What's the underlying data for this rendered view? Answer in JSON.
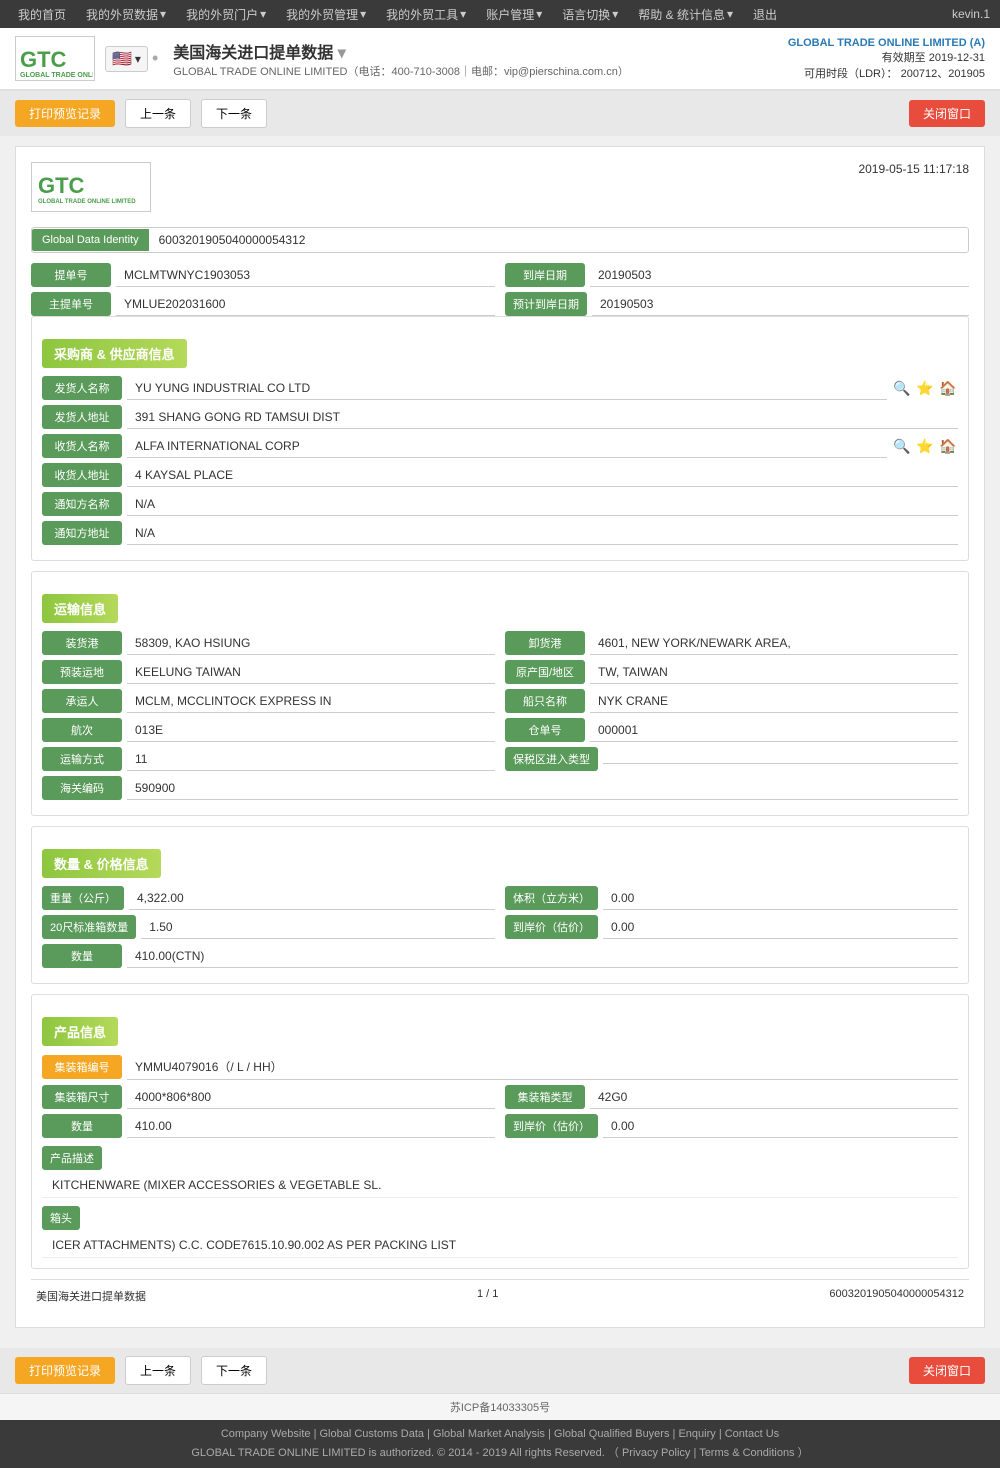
{
  "topnav": {
    "items": [
      "我的首页",
      "我的外贸数据",
      "我的外贸门户",
      "我的外贸管理",
      "我的外贸工具",
      "账户管理",
      "语言切换",
      "帮助 & 统计信息",
      "退出"
    ],
    "user": "kevin.1"
  },
  "header": {
    "logo_text": "GTC",
    "title": "美国海关进口提单数据",
    "subtitle": "GLOBAL TRADE ONLINE LIMITED（电话：400-710-3008｜电邮：vip@pierschina.com.cn）",
    "company": "GLOBAL TRADE ONLINE LIMITED (A)",
    "valid_until_label": "有效期至",
    "valid_until": "2019-12-31",
    "ldr_label": "可用时段（LDR）：",
    "ldr_value": "200712、201905"
  },
  "toolbar": {
    "print_label": "打印预览记录",
    "prev_label": "上一条",
    "next_label": "下一条",
    "close_label": "关闭窗口"
  },
  "document": {
    "date": "2019-05-15 11:17:18",
    "logo_text": "GTC",
    "gdi_label": "Global Data Identity",
    "gdi_value": "6003201905040000054312",
    "bill_no_label": "提单号",
    "bill_no_value": "MCLMTWNYC1903053",
    "arrival_date_label": "到岸日期",
    "arrival_date_value": "20190503",
    "master_bill_label": "主提单号",
    "master_bill_value": "YMLUE202031600",
    "estimated_arrival_label": "预计到岸日期",
    "estimated_arrival_value": "20190503",
    "sections": {
      "buyer_supplier": {
        "title": "采购商 & 供应商信息",
        "shipper_name_label": "发货人名称",
        "shipper_name_value": "YU YUNG INDUSTRIAL CO LTD",
        "shipper_addr_label": "发货人地址",
        "shipper_addr_value": "391 SHANG GONG RD TAMSUI DIST",
        "consignee_name_label": "收货人名称",
        "consignee_name_value": "ALFA INTERNATIONAL CORP",
        "consignee_addr_label": "收货人地址",
        "consignee_addr_value": "4 KAYSAL PLACE",
        "notify_name_label": "通知方名称",
        "notify_name_value": "N/A",
        "notify_addr_label": "通知方地址",
        "notify_addr_value": "N/A"
      },
      "transport": {
        "title": "运输信息",
        "loading_port_label": "装货港",
        "loading_port_value": "58309, KAO HSIUNG",
        "unloading_port_label": "卸货港",
        "unloading_port_value": "4601, NEW YORK/NEWARK AREA,",
        "pre_transit_label": "预装运地",
        "pre_transit_value": "KEELUNG TAIWAN",
        "origin_label": "原产国/地区",
        "origin_value": "TW, TAIWAN",
        "carrier_label": "承运人",
        "carrier_value": "MCLM, MCCLINTOCK EXPRESS IN",
        "vessel_label": "船只名称",
        "vessel_value": "NYK CRANE",
        "voyage_label": "航次",
        "voyage_value": "013E",
        "bill_type_label": "仓单号",
        "bill_type_value": "000001",
        "transport_mode_label": "运输方式",
        "transport_mode_value": "11",
        "free_trade_label": "保税区进入类型",
        "free_trade_value": "",
        "customs_code_label": "海关编码",
        "customs_code_value": "590900"
      },
      "quantity_price": {
        "title": "数量 & 价格信息",
        "weight_label": "重量（公斤）",
        "weight_value": "4,322.00",
        "volume_label": "体积（立方米）",
        "volume_value": "0.00",
        "container20_label": "20尺标准箱数量",
        "container20_value": "1.50",
        "landed_price_label": "到岸价（估价）",
        "landed_price_value": "0.00",
        "quantity_label": "数量",
        "quantity_value": "410.00(CTN)"
      },
      "product": {
        "title": "产品信息",
        "container_no_label": "集装箱编号",
        "container_no_value": "YMMU4079016（/ L / HH）",
        "container_size_label": "集装箱尺寸",
        "container_size_value": "4000*806*800",
        "container_type_label": "集装箱类型",
        "container_type_value": "42G0",
        "quantity_label": "数量",
        "quantity_value": "410.00",
        "landed_price_label": "到岸价（估价）",
        "landed_price_value": "0.00",
        "product_desc_label": "产品描述",
        "product_desc_value": "KITCHENWARE (MIXER ACCESSORIES & VEGETABLE SL.",
        "header_label": "箱头",
        "header_value": "ICER ATTACHMENTS) C.C. CODE7615.10.90.002 AS PER PACKING LIST"
      }
    },
    "footer": {
      "title": "美国海关进口提单数据",
      "page": "1 / 1",
      "id": "6003201905040000054312"
    }
  },
  "page_footer": {
    "icp": "苏ICP备14033305号",
    "links": [
      "Company Website",
      "Global Customs Data",
      "Global Market Analysis",
      "Global Qualified Buyers",
      "Enquiry",
      "Contact Us"
    ],
    "copyright": "GLOBAL TRADE ONLINE LIMITED is authorized. © 2014 - 2019 All rights Reserved.",
    "privacy": "Privacy Policy",
    "terms": "Terms & Conditions"
  }
}
